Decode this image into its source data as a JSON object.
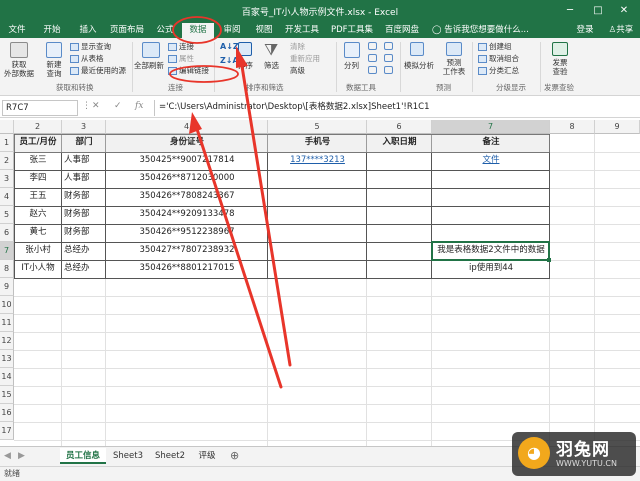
{
  "title": "百家号_IT小人物示例文件.xlsx - Excel",
  "account": {
    "login": "登录",
    "share": "共享"
  },
  "tabs": [
    "文件",
    "开始",
    "插入",
    "页面布局",
    "公式",
    "数据",
    "审阅",
    "视图",
    "开发工具",
    "PDF工具集",
    "百度网盘"
  ],
  "tell_me": "告诉我您想要做什么...",
  "ribbon": {
    "get_external": "获取\n外部数据",
    "new_query": "新建\n查询",
    "show_query": "显示查询",
    "from_table": "从表格",
    "recent_source": "最近使用的源",
    "grp_get_transform": "获取和转换",
    "refresh_all": "全部刷新",
    "connections": "连接",
    "properties": "属性",
    "edit_links": "编辑链接",
    "grp_connections": "连接",
    "sort": "排序",
    "filter": "筛选",
    "clear": "清除",
    "reapply": "重新应用",
    "advanced": "高级",
    "grp_sort_filter": "排序和筛选",
    "split": "分列",
    "grp_data_tools": "数据工具",
    "what_if": "模拟分析",
    "forecast_sheet": "预测\n工作表",
    "grp_forecast": "预测",
    "group": "创建组",
    "ungroup": "取消组合",
    "subtotal": "分类汇总",
    "grp_outline": "分级显示",
    "invoice": "发票\n查验",
    "grp_invoice": "发票查验"
  },
  "namebox": "R7C7",
  "formula": "='C:\\Users\\Administrator\\Desktop\\[表格数据2.xlsx]Sheet1'!R1C1",
  "col_headers": [
    "2",
    "3",
    "4",
    "5",
    "6",
    "7",
    "8",
    "9"
  ],
  "row_headers": [
    "1",
    "2",
    "3",
    "4",
    "5",
    "6",
    "7",
    "8",
    "9",
    "10",
    "11",
    "12",
    "13",
    "14",
    "15",
    "16",
    "17"
  ],
  "header_row": [
    "员工/月份",
    "部门",
    "身份证号",
    "手机号",
    "入职日期",
    "备注"
  ],
  "rows": [
    [
      "张三",
      "人事部",
      "350425**9007217814",
      "137****3213",
      "",
      "文件"
    ],
    [
      "李四",
      "人事部",
      "350426**8712030000",
      "",
      "",
      ""
    ],
    [
      "王五",
      "财务部",
      "350426**7808243367",
      "",
      "",
      ""
    ],
    [
      "赵六",
      "财务部",
      "350424**9209133478",
      "",
      "",
      ""
    ],
    [
      "黄七",
      "财务部",
      "350426**9512238967",
      "",
      "",
      ""
    ],
    [
      "张小村",
      "总经办",
      "350427**7807238932",
      "",
      "",
      "我是表格数据2文件中的数据"
    ],
    [
      "IT小人物",
      "总经办",
      "350426**8801217015",
      "",
      "",
      "ip使用到44"
    ]
  ],
  "sheet_tabs": [
    "员工信息",
    "Sheet3",
    "Sheet2",
    "评级"
  ],
  "status": "就绪",
  "watermark": {
    "brand": "羽兔网",
    "url": "WWW.YUTU.CN"
  },
  "colors": {
    "excel_green": "#217346",
    "link": "#1f5faa",
    "annotation_red": "#e8352a"
  }
}
